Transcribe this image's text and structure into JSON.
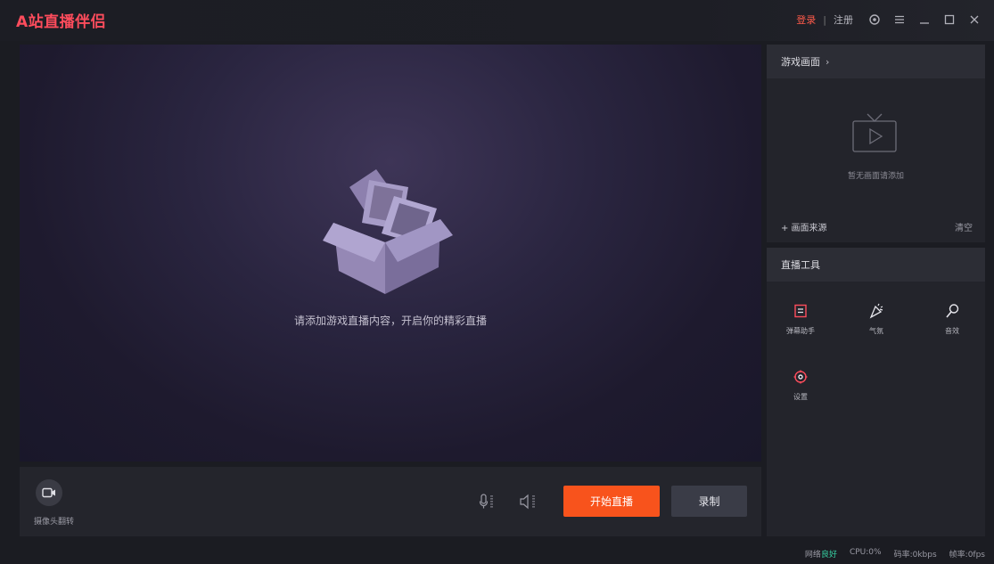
{
  "app": {
    "title": "A站直播伴侣"
  },
  "titlebar": {
    "login": "登录",
    "separator": "|",
    "register": "注册",
    "icons": [
      "gear-icon",
      "menu-icon",
      "minimize-icon",
      "maximize-icon",
      "close-icon"
    ]
  },
  "preview": {
    "hint": "请添加游戏直播内容，开启你的精彩直播",
    "illustration": "open-box"
  },
  "controls": {
    "camera_label": "摄像头翻转",
    "start_label": "开始直播",
    "record_label": "录制"
  },
  "source_panel": {
    "title": "游戏画面",
    "empty_text": "暂无画面请添加",
    "add_label": "+ 画面来源",
    "clear_label": "清空"
  },
  "tools_panel": {
    "title": "直播工具",
    "items": [
      {
        "label": "弹幕助手",
        "icon": "danmaku-icon"
      },
      {
        "label": "气氛",
        "icon": "party-popper-icon"
      },
      {
        "label": "音效",
        "icon": "mic-icon"
      },
      {
        "label": "设置",
        "icon": "settings-icon"
      }
    ]
  },
  "status": {
    "network_label": "网络",
    "network_value": "良好",
    "cpu": "CPU:0%",
    "bitrate": "码率:0kbps",
    "fps": "帧率:0fps"
  },
  "colors": {
    "brand": "#fd4c5c",
    "start_button": "#f8531c",
    "network_good": "#37d2a4"
  }
}
